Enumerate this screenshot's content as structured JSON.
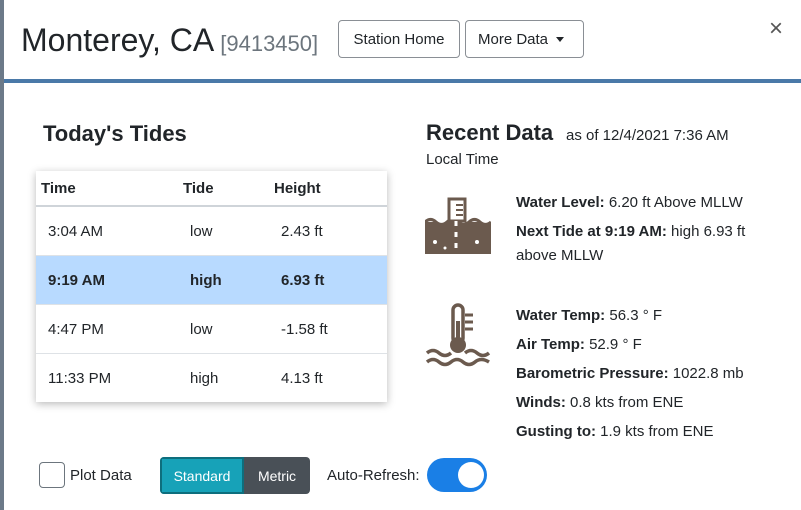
{
  "header": {
    "title": "Monterey, CA",
    "station_id": "[9413450]",
    "station_home_label": "Station Home",
    "more_data_label": "More Data",
    "close_label": "×"
  },
  "tides": {
    "title": "Today's Tides",
    "columns": [
      "Time",
      "Tide",
      "Height"
    ],
    "rows": [
      {
        "time": "3:04 AM",
        "tide": "low",
        "height": "2.43 ft",
        "highlighted": false
      },
      {
        "time": "9:19 AM",
        "tide": "high",
        "height": "6.93 ft",
        "highlighted": true
      },
      {
        "time": "4:47 PM",
        "tide": "low",
        "height": "-1.58 ft",
        "highlighted": false
      },
      {
        "time": "11:33 PM",
        "tide": "high",
        "height": "4.13 ft",
        "highlighted": false
      }
    ]
  },
  "recent": {
    "title": "Recent Data",
    "as_of": "as of 12/4/2021 7:36 AM",
    "local_time": "Local Time",
    "water_level_label": "Water Level:",
    "water_level_value": "6.20 ft Above MLLW",
    "next_tide_label": "Next Tide at 9:19 AM:",
    "next_tide_value": "high 6.93 ft above MLLW",
    "water_temp_label": "Water Temp:",
    "water_temp_value": "56.3 ° F",
    "air_temp_label": "Air Temp:",
    "air_temp_value": "52.9 ° F",
    "pressure_label": "Barometric Pressure:",
    "pressure_value": "1022.8 mb",
    "winds_label": "Winds:",
    "winds_value": "0.8 kts from ENE",
    "gust_label": "Gusting to:",
    "gust_value": "1.9 kts from ENE",
    "icons": [
      "water-level-icon",
      "temperature-icon"
    ]
  },
  "footer": {
    "plot_data_label": "Plot Data",
    "plot_data_checked": false,
    "units": [
      "Standard",
      "Metric"
    ],
    "units_selected": "Standard",
    "auto_refresh_label": "Auto-Refresh:",
    "auto_refresh_on": true
  },
  "colors": {
    "header_rule": "#4a79a8",
    "row_highlight": "#b8daff",
    "standard_btn": "#17a2b8",
    "metric_btn": "#495057",
    "toggle_on": "#1a7fe6",
    "icon_brown": "#6b5a4e"
  }
}
